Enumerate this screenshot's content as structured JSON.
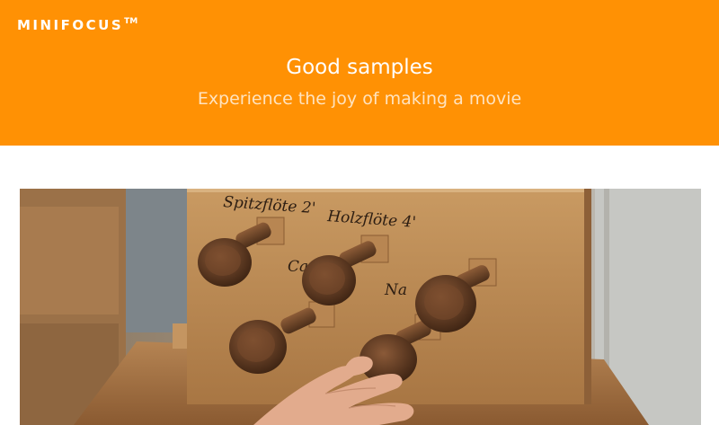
{
  "brand": {
    "name": "MINIFOCUS",
    "trademark": "TM"
  },
  "banner": {
    "title": "Good samples",
    "subtitle": "Experience the joy of making a movie",
    "color": "#ff9104"
  },
  "photo": {
    "labels": [
      "Spitzflöte 2'",
      "Holzflöte 4'",
      "Ca",
      "Na"
    ]
  }
}
